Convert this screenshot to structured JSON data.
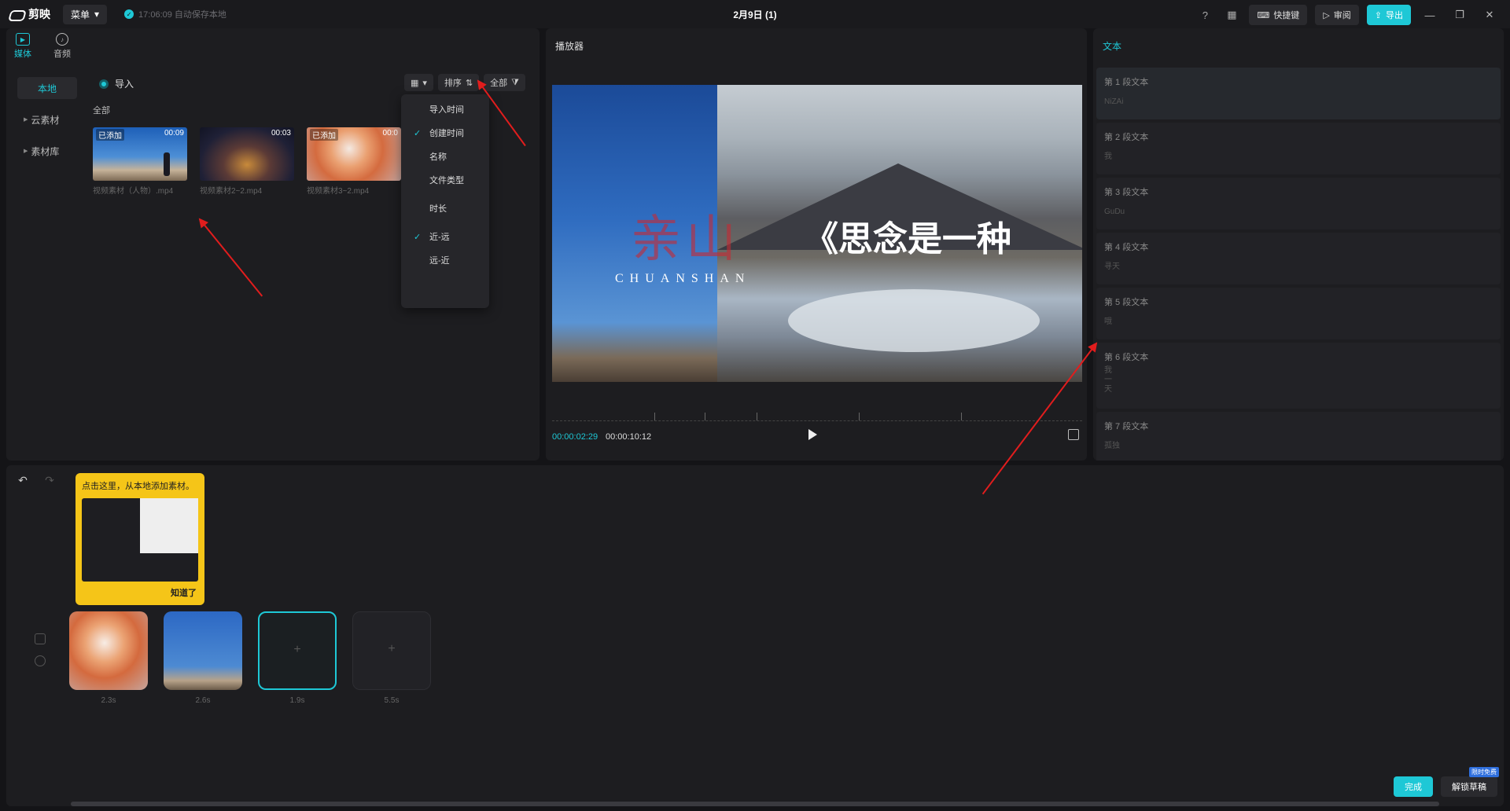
{
  "titlebar": {
    "app_name": "剪映",
    "menu_label": "菜单",
    "save_status": "17:06:09 自动保存本地",
    "project_title": "2月9日 (1)",
    "shortcuts_label": "快捷键",
    "review_label": "审阅",
    "export_label": "导出"
  },
  "media": {
    "tabs": [
      {
        "label": "媒体",
        "icon": "media-icon"
      },
      {
        "label": "音频",
        "icon": "audio-icon"
      }
    ],
    "side_nav": [
      "本地",
      "云素材",
      "素材库"
    ],
    "import_label": "导入",
    "all_label": "全部",
    "sort_label": "排序",
    "filter_label": "全部",
    "thumbnails": [
      {
        "badge": "已添加",
        "duration": "00:09",
        "name": "视频素材（人物）.mp4"
      },
      {
        "badge": "",
        "duration": "00:03",
        "name": "视频素材2~2.mp4"
      },
      {
        "badge": "已添加",
        "duration": "00:0",
        "name": "视频素材3~2.mp4"
      }
    ],
    "sort_menu": [
      {
        "label": "导入时间",
        "checked": false
      },
      {
        "label": "创建时间",
        "checked": true
      },
      {
        "label": "名称",
        "checked": false
      },
      {
        "label": "文件类型",
        "checked": false
      },
      {
        "label": "时长",
        "checked": false
      },
      {
        "label": "近-远",
        "checked": true
      },
      {
        "label": "远-近",
        "checked": false
      }
    ]
  },
  "player": {
    "title": "播放器",
    "overlay_cn": "亲山",
    "overlay_en": "CHUANSHAN",
    "overlay_quote": "《思念是一种",
    "current_time": "00:00:02:29",
    "total_time": "00:00:10:12"
  },
  "text_panel": {
    "title": "文本",
    "segments": [
      {
        "label": "第 1 段文本",
        "content": "NiZAi"
      },
      {
        "label": "第 2 段文本",
        "content": "我"
      },
      {
        "label": "第 3 段文本",
        "content": "GuDu"
      },
      {
        "label": "第 4 段文本",
        "content": "寻天"
      },
      {
        "label": "第 5 段文本",
        "content": "哦"
      },
      {
        "label": "第 6 段文本",
        "content": "我\n一\n天"
      },
      {
        "label": "第 7 段文本",
        "content": "孤独"
      }
    ]
  },
  "timeline": {
    "tooltip_text": "点击这里，从本地添加素材。",
    "tooltip_ok": "知道了",
    "clips": [
      {
        "duration": "2.3s"
      },
      {
        "duration": "2.6s"
      },
      {
        "duration": "1.9s"
      },
      {
        "duration": "5.5s"
      }
    ],
    "action_primary": "完成",
    "action_secondary": "解锁草稿",
    "action_badge": "限时免费"
  },
  "colors": {
    "accent": "#1ec8d6",
    "tooltip": "#f5c518",
    "annotation": "#e11d1d"
  }
}
